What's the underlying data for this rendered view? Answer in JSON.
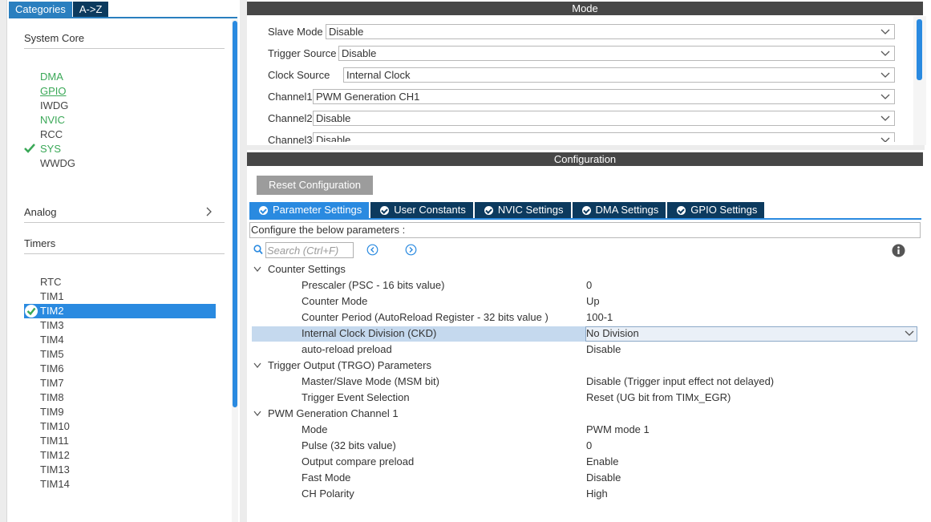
{
  "left": {
    "tabs": [
      "Categories",
      "A->Z"
    ],
    "system_core": {
      "title": "System Core",
      "items": [
        {
          "label": "DMA",
          "state": "green"
        },
        {
          "label": "GPIO",
          "state": "green-underline"
        },
        {
          "label": "IWDG",
          "state": "plain"
        },
        {
          "label": "NVIC",
          "state": "green"
        },
        {
          "label": "RCC",
          "state": "plain"
        },
        {
          "label": "SYS",
          "state": "green-check"
        },
        {
          "label": "WWDG",
          "state": "plain"
        }
      ]
    },
    "analog": {
      "title": "Analog"
    },
    "timers": {
      "title": "Timers",
      "items": [
        "RTC",
        "TIM1",
        "TIM2",
        "TIM3",
        "TIM4",
        "TIM5",
        "TIM6",
        "TIM7",
        "TIM8",
        "TIM9",
        "TIM10",
        "TIM11",
        "TIM12",
        "TIM13",
        "TIM14"
      ],
      "selected": "TIM2"
    }
  },
  "mode": {
    "header": "Mode",
    "rows": [
      {
        "label": "Slave Mode",
        "value": "Disable"
      },
      {
        "label": "Trigger Source",
        "value": "Disable"
      },
      {
        "label": "Clock Source",
        "value": "Internal Clock"
      },
      {
        "label": "Channel1",
        "value": "PWM Generation CH1"
      },
      {
        "label": "Channel2",
        "value": "Disable"
      },
      {
        "label": "Channel3",
        "value": "Disable"
      }
    ]
  },
  "config": {
    "header": "Configuration",
    "reset_label": "Reset Configuration",
    "tabs": [
      "Parameter Settings",
      "User Constants",
      "NVIC Settings",
      "DMA Settings",
      "GPIO Settings"
    ],
    "active_tab": "Parameter Settings",
    "info": "Configure the below parameters :",
    "search_placeholder": "Search (Ctrl+F)",
    "groups": [
      {
        "title": "Counter Settings",
        "params": [
          {
            "name": "Prescaler (PSC - 16 bits value)",
            "value": "0"
          },
          {
            "name": "Counter Mode",
            "value": "Up"
          },
          {
            "name": "Counter Period (AutoReload Register - 32 bits value )",
            "value": "100-1"
          },
          {
            "name": "Internal Clock Division (CKD)",
            "value": "No Division"
          },
          {
            "name": "auto-reload preload",
            "value": "Disable"
          }
        ]
      },
      {
        "title": "Trigger Output (TRGO) Parameters",
        "params": [
          {
            "name": "Master/Slave Mode (MSM bit)",
            "value": "Disable (Trigger input effect not delayed)"
          },
          {
            "name": "Trigger Event Selection",
            "value": "Reset (UG bit from TIMx_EGR)"
          }
        ]
      },
      {
        "title": "PWM Generation Channel 1",
        "params": [
          {
            "name": "Mode",
            "value": "PWM mode 1"
          },
          {
            "name": "Pulse (32 bits value)",
            "value": "0"
          },
          {
            "name": "Output compare preload",
            "value": "Enable"
          },
          {
            "name": "Fast Mode",
            "value": "Disable"
          },
          {
            "name": "CH Polarity",
            "value": "High"
          }
        ]
      }
    ]
  },
  "colors": {
    "accent": "#2a8ae0",
    "dark_tab": "#0c3a5e",
    "enabled_green": "#3aa857",
    "header_gray": "#474747"
  }
}
